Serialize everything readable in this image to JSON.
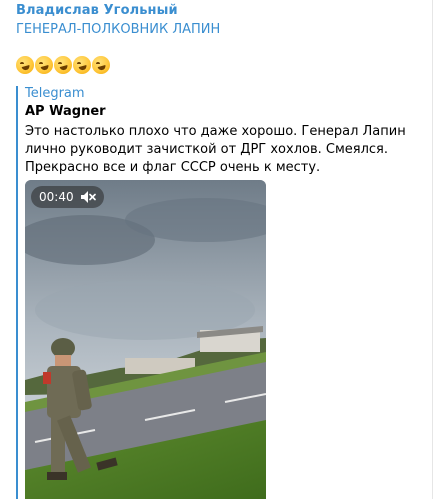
{
  "message": {
    "sender": "Владислав Угольный",
    "headline": "ГЕНЕРАЛ-ПОЛКОВНИК ЛАПИН",
    "emojis": [
      "rofl-emoji",
      "rofl-emoji",
      "rofl-emoji",
      "rofl-emoji",
      "rofl-emoji"
    ],
    "forwarded": {
      "source": "Telegram",
      "author": "AP Wagner",
      "text": "Это настолько плохо что даже хорошо. Генерал Лапин лично руководит зачисткой от ДРГ хохлов. Смеялся. Прекрасно все и флаг СССР очень к месту.",
      "video": {
        "duration": "00:40",
        "muted_icon": "speaker-muted-icon"
      }
    }
  },
  "colors": {
    "accent": "#3a8ed0",
    "text": "#000000",
    "background": "#ffffff"
  }
}
